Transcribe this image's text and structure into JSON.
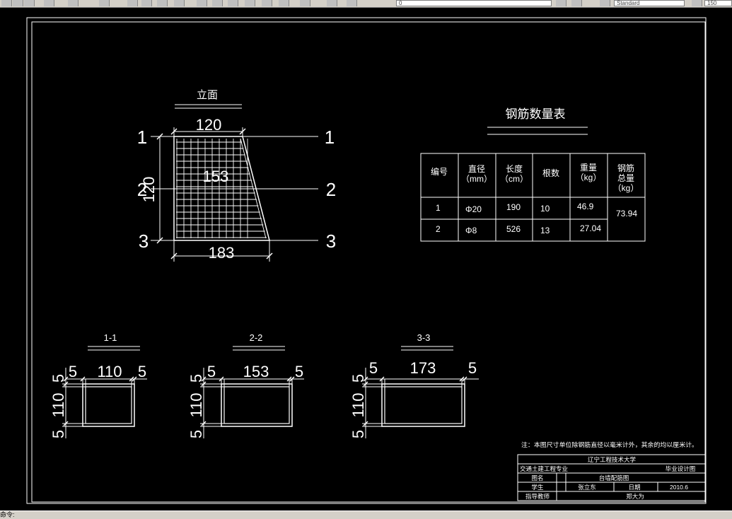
{
  "toolbar": {
    "style_select": "Standard",
    "scale_select": "150",
    "layer_value": "0"
  },
  "status": {
    "text": "命令:"
  },
  "elevation": {
    "title": "立面",
    "top_dim": "120",
    "bottom_dim": "183",
    "mid_dim": "153",
    "height_dim": "120",
    "section_marks": [
      "1",
      "2",
      "3"
    ]
  },
  "table": {
    "title": "钢筋数量表",
    "headers": [
      "编号",
      "直径\n（mm）",
      "长度\n（cm）",
      "根数",
      "重量\n（kg）",
      "钢筋\n总量\n（kg）"
    ],
    "rows": [
      {
        "no": "1",
        "dia": "Φ20",
        "len": "190",
        "count": "10",
        "weight": "46.9"
      },
      {
        "no": "2",
        "dia": "Φ8",
        "len": "526",
        "count": "13",
        "weight": "27.04"
      }
    ],
    "total": "73.94"
  },
  "sections": [
    {
      "title": "1-1",
      "left": "5",
      "width": "110",
      "right": "5",
      "height": "110",
      "bottom": "5",
      "top": "5"
    },
    {
      "title": "2-2",
      "left": "5",
      "width": "153",
      "right": "5",
      "height": "110",
      "bottom": "5",
      "top": "5"
    },
    {
      "title": "3-3",
      "left": "5",
      "width": "173",
      "right": "5",
      "height": "110",
      "bottom": "5",
      "top": "5"
    }
  ],
  "note": "注：本图尺寸单位除钢筋直径以毫米计外，其余的均以厘米计。",
  "title_block": {
    "university": "辽宁工程技术大学",
    "major": "交通土建工程专业",
    "design_type": "毕业设计图",
    "drawing_name_label": "图名",
    "drawing_name": "台墙配筋图",
    "student_label": "学生",
    "student": "张立东",
    "date_label": "日期",
    "date": "2010.6",
    "teacher_label": "指导教师",
    "teacher": "郑大为"
  }
}
